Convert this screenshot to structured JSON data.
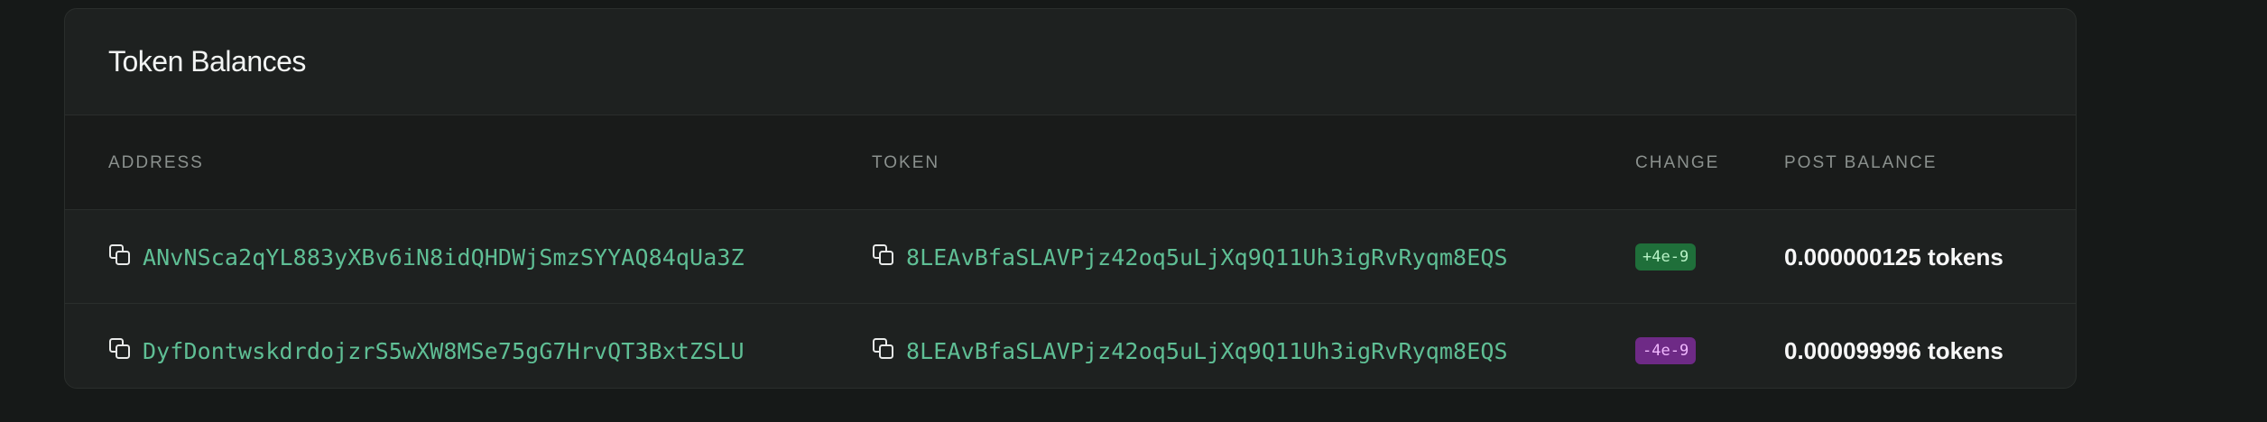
{
  "card": {
    "title": "Token Balances",
    "columns": {
      "address": "ADDRESS",
      "token": "TOKEN",
      "change": "CHANGE",
      "post_balance": "POST BALANCE"
    },
    "rows": [
      {
        "address": "ANvNSca2qYL883yXBv6iN8idQHDWjSmzSYYAQ84qUa3Z",
        "token": "8LEAvBfaSLAVPjz42oq5uLjXq9Q11Uh3igRvRyqm8EQS",
        "change": "+4e-9",
        "change_type": "positive",
        "post_balance": "0.000000125 tokens"
      },
      {
        "address": "DyfDontwskdrdojzrS5wXW8MSe75gG7HrvQT3BxtZSLU",
        "token": "8LEAvBfaSLAVPjz42oq5uLjXq9Q11Uh3igRvRyqm8EQS",
        "change": "-4e-9",
        "change_type": "negative",
        "post_balance": "0.000099996 tokens"
      }
    ]
  },
  "icons": {
    "copy": "copy-icon"
  },
  "colors": {
    "link": "#5fbf95",
    "positive_badge": "#1f6f3a",
    "negative_badge": "#6e2a86"
  }
}
